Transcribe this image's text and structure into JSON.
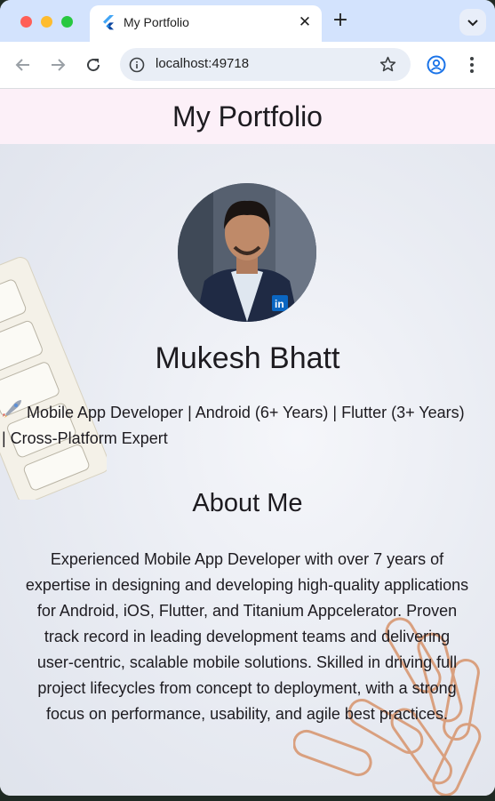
{
  "browser": {
    "tab_title": "My Portfolio",
    "url": "localhost:49718",
    "icons": {
      "back": "arrow-left-icon",
      "forward": "arrow-right-icon",
      "reload": "reload-icon",
      "site_info": "info-icon",
      "bookmark": "star-icon",
      "profile": "profile-icon",
      "menu": "kebab-menu-icon",
      "tab_close": "close-icon",
      "new_tab": "plus-icon",
      "tab_search": "chevron-down-icon"
    }
  },
  "app": {
    "title": "My Portfolio",
    "profile": {
      "name": "Mukesh Bhatt",
      "tagline_icon": "rocket-icon",
      "tagline": "Mobile App Developer | Android (6+ Years) | Flutter (3+ Years) | Cross-Platform Expert"
    },
    "about": {
      "heading": "About Me",
      "body": "Experienced Mobile App Developer with over 7 years of expertise in designing and developing high-quality applications for Android, iOS, Flutter, and Titanium Appcelerator. Proven track record in leading development teams and delivering user-centric, scalable mobile solutions. Skilled in driving full project lifecycles from concept to deployment, with a strong focus on performance, usability, and agile best practices."
    },
    "colors": {
      "appbar_bg": "#fcf0f8",
      "text": "#1d1b20",
      "tabstrip_bg": "#d3e3fd"
    }
  }
}
